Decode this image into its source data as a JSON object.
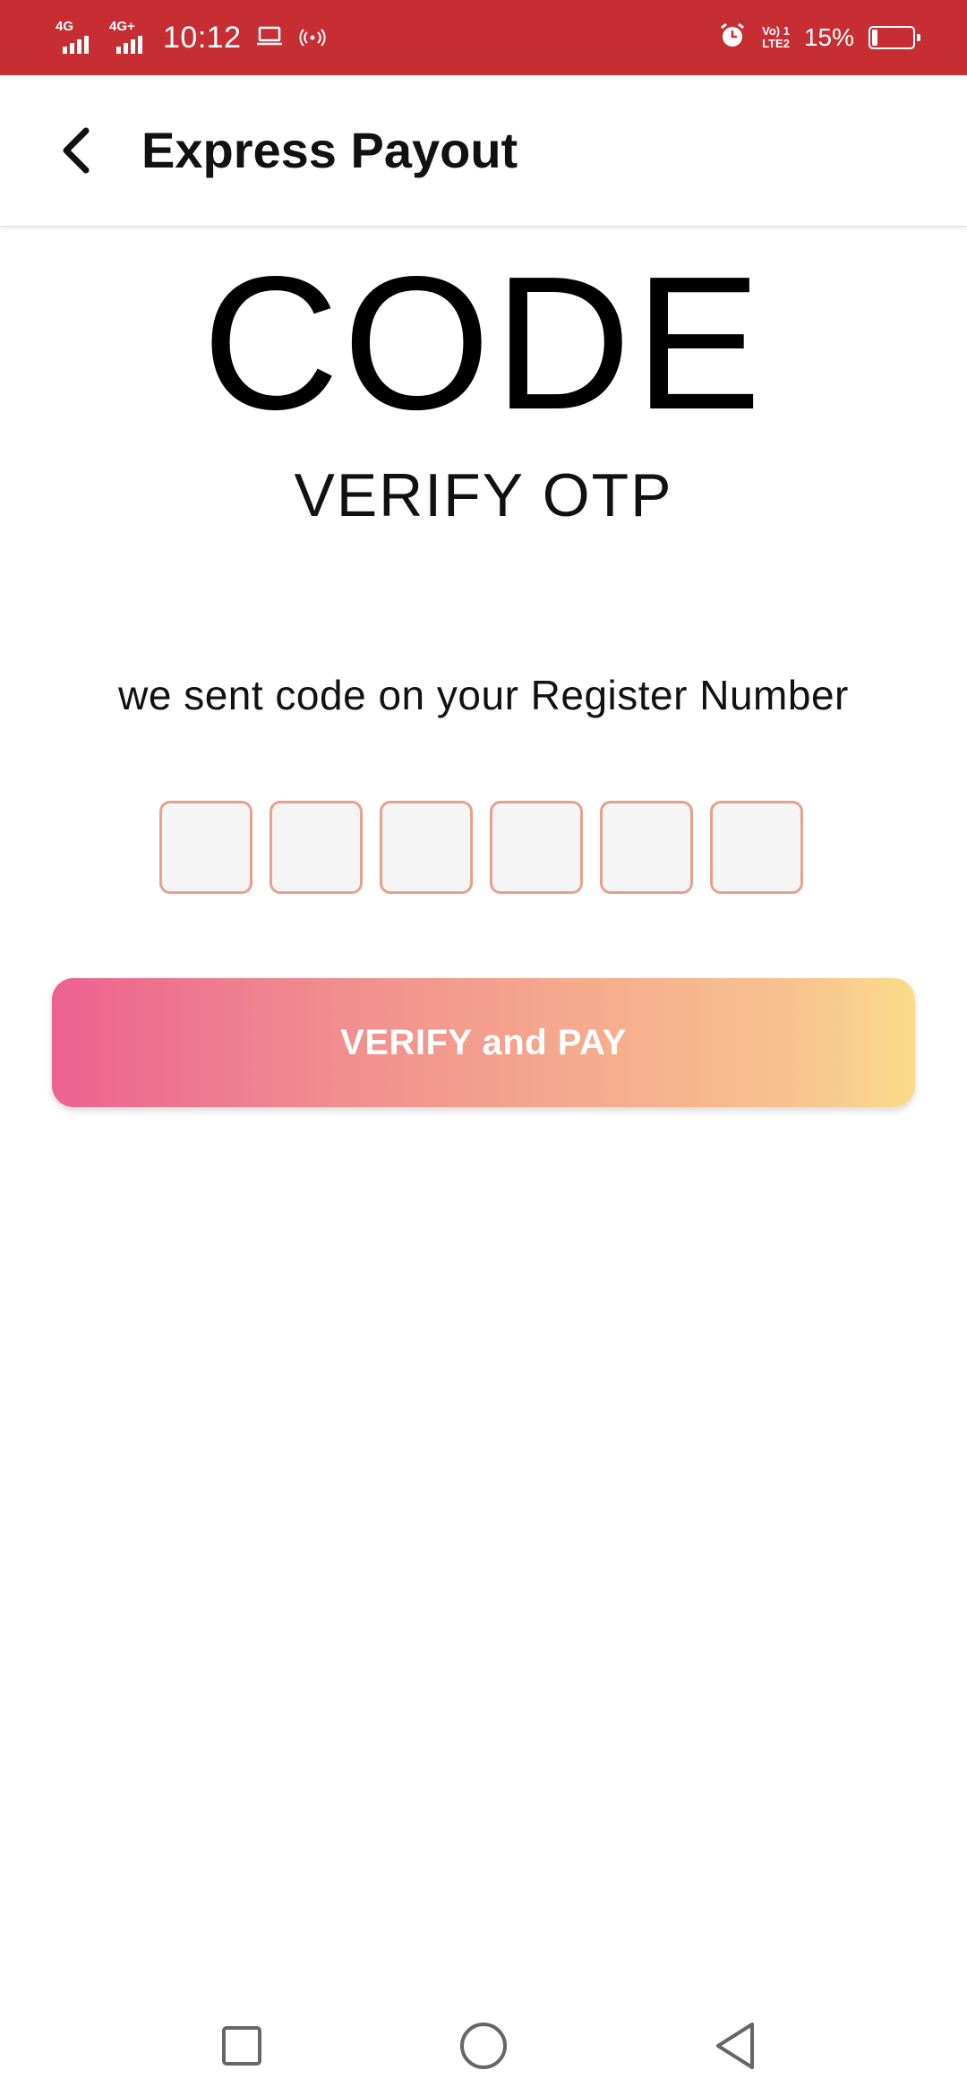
{
  "status_bar": {
    "network_1": "4G",
    "network_2": "4G+",
    "time": "10:12",
    "laptop_icon": "laptop-icon",
    "hotspot_icon": "hotspot-icon",
    "alarm_icon": "alarm-icon",
    "volte_line1": "Vo) 1",
    "volte_line2": "LTE2",
    "battery_percent": "15%",
    "battery_level": 0.15
  },
  "app_bar": {
    "back_icon": "back-arrow-icon",
    "title": "Express Payout"
  },
  "main": {
    "heading": "CODE",
    "subheading": "VERIFY OTP",
    "info_text": "we sent code on your Register Number",
    "otp_digits": [
      "",
      "",
      "",
      "",
      "",
      ""
    ],
    "pay_button_label": "VERIFY and PAY"
  },
  "nav_bar": {
    "recents_icon": "square-recents-icon",
    "home_icon": "circle-home-icon",
    "back_icon": "triangle-back-icon"
  },
  "colors": {
    "status_bar": "#c62e33",
    "otp_border": "#e8a08e",
    "button_gradient_start": "#ec6191",
    "button_gradient_end": "#fadb8a"
  }
}
